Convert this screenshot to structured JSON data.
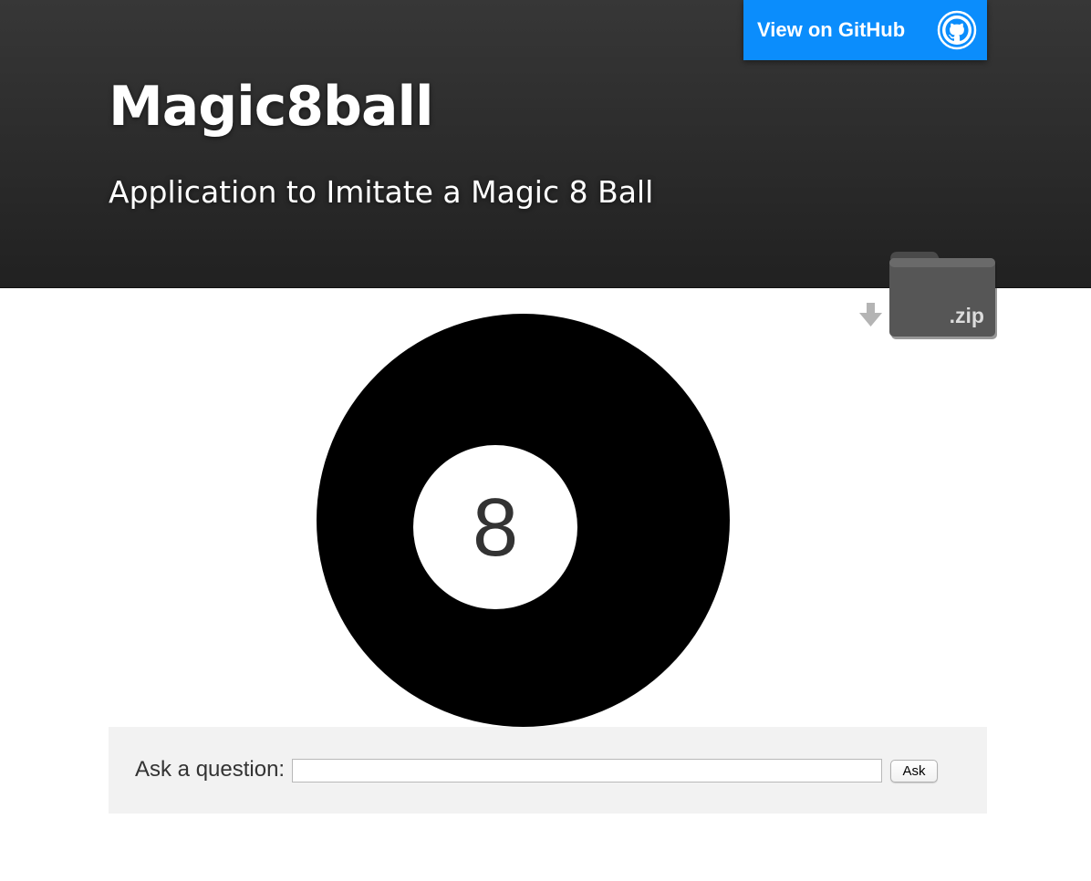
{
  "header": {
    "title": "Magic8ball",
    "tagline": "Application to Imitate a Magic 8 Ball",
    "github_button": {
      "label": "View on GitHub",
      "icon": "github-octocat-icon",
      "color": "#0b8dfc"
    },
    "download": {
      "label": ".zip",
      "icon": "zip-folder-icon",
      "arrow_icon": "download-arrow-icon"
    }
  },
  "ball": {
    "number": "8",
    "ball_color": "#000000",
    "window_color": "#ffffff"
  },
  "question_form": {
    "label": "Ask a question:",
    "input_value": "",
    "button_label": "Ask"
  }
}
